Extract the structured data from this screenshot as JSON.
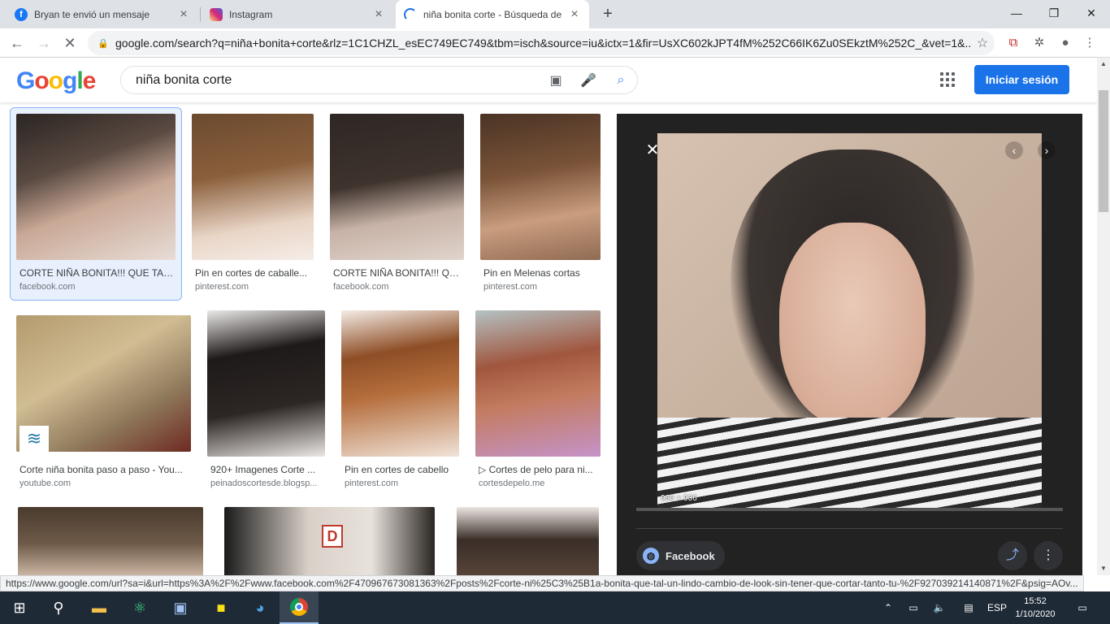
{
  "browser": {
    "tabs": [
      {
        "title": "Bryan te envió un mensaje",
        "icon": "facebook-icon",
        "color": "#1877f2"
      },
      {
        "title": "Instagram",
        "icon": "instagram-icon",
        "color": "#d62976"
      },
      {
        "title": "niña bonita corte - Búsqueda de",
        "icon": "loading-icon",
        "color": "#1a73e8"
      }
    ],
    "new_tab": "+",
    "url": "google.com/search?q=niña+bonita+corte&rlz=1C1CHZL_esEC749EC749&tbm=isch&source=iu&ictx=1&fir=UsXC602kJPT4fM%252C66IK6Zu0SEkztM%252C_&vet=1&..."
  },
  "google": {
    "logo": "Google",
    "query": "niña bonita corte",
    "signin": "Iniciar sesión"
  },
  "results": [
    {
      "caption": "CORTE NIÑA BONITA!!! QUE TAL...",
      "source": "facebook.com"
    },
    {
      "caption": "Pin en cortes de caballe...",
      "source": "pinterest.com"
    },
    {
      "caption": "CORTE NIÑA BONITA!!! QU...",
      "source": "facebook.com"
    },
    {
      "caption": "Pin en Melenas cortas",
      "source": "pinterest.com"
    },
    {
      "caption": "Corte niña bonita paso a paso - You...",
      "source": "youtube.com"
    },
    {
      "caption": "920+ Imagenes Corte ...",
      "source": "peinadoscortesde.blogsp..."
    },
    {
      "caption": "Pin en cortes de cabello",
      "source": "pinterest.com"
    },
    {
      "caption": "▷ Cortes de pelo para ni...",
      "source": "cortesdepelo.me"
    }
  ],
  "preview": {
    "dimensions": "960 × 936",
    "source_name": "Facebook"
  },
  "status_url": "https://www.google.com/url?sa=i&url=https%3A%2F%2Fwww.facebook.com%2F470967673081363%2Fposts%2Fcorte-ni%25C3%25B1a-bonita-que-tal-un-lindo-cambio-de-look-sin-tener-que-cortar-tanto-tu-%2F927039214140871%2F&psig=AOv...",
  "taskbar": {
    "lang": "ESP",
    "time": "15:52",
    "date": "1/10/2020"
  },
  "colors": {
    "accent": "#1a73e8",
    "logo": [
      "#4285f4",
      "#ea4335",
      "#fbbc05",
      "#4285f4",
      "#34a853",
      "#ea4335"
    ]
  }
}
